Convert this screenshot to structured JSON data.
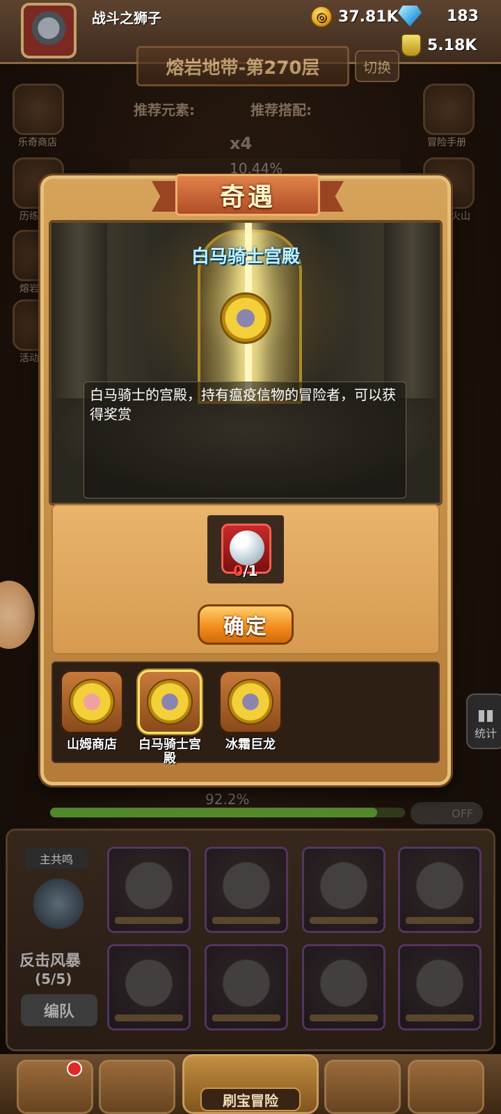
{
  "player": {
    "name": "战斗之狮子",
    "gold": "37.81K",
    "gems": "183",
    "potions": "5.18K"
  },
  "stage": {
    "title": "熔岩地带-第270层",
    "switch_label": "切换",
    "recommended_element_label": "推荐元素:",
    "recommended_combo_label": "推荐搭配:",
    "skull_count": "x4",
    "progress_text": "10.44%"
  },
  "side_menu": {
    "left": [
      "乐奇商店",
      "历练",
      "熔岩",
      "活动"
    ],
    "right": [
      "冒险手册",
      "火山"
    ]
  },
  "modal": {
    "title": "奇遇",
    "location_title": "白马骑士宫殿",
    "description": "白马骑士的宫殿，持有瘟疫信物的冒险者，可以获得奖赏",
    "required_have": "0",
    "required_need": "/1",
    "confirm_label": "确定",
    "events": [
      {
        "label": "山姆商店",
        "icon": "pig-emblem-icon"
      },
      {
        "label": "白马骑士宫殿",
        "icon": "knight-helmet-emblem-icon"
      },
      {
        "label": "冰霜巨龙",
        "icon": "knight-helmet-emblem-icon"
      }
    ],
    "selected_event_index": 1
  },
  "bottom": {
    "progress_text": "92.2%",
    "progress_value": 0.922,
    "toggle_label": "OFF",
    "stats_label": "统计",
    "resonance_tag": "主共鸣",
    "resonance_name": "反击风暴",
    "resonance_count": "(5/5)",
    "formation_label": "编队",
    "nav_center_label": "刷宝冒险"
  }
}
